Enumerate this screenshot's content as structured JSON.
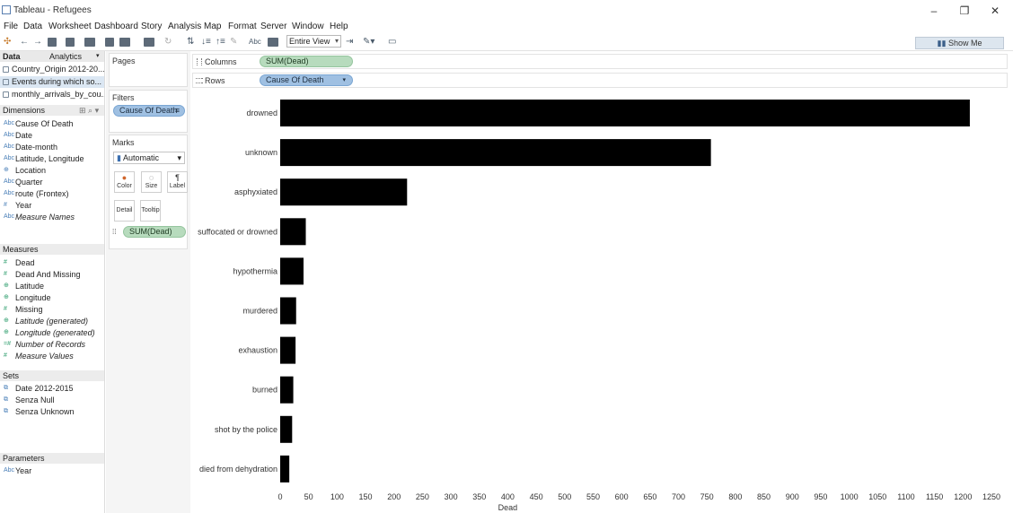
{
  "window": {
    "title": "Tableau - Refugees"
  },
  "menu": [
    "File",
    "Data",
    "Worksheet",
    "Dashboard",
    "Story",
    "Analysis",
    "Map",
    "Format",
    "Server",
    "Window",
    "Help"
  ],
  "toolbar": {
    "fit": "Entire View",
    "abc": "Abc",
    "show_me": "Show Me"
  },
  "data_pane": {
    "tabs": [
      "Data",
      "Analytics"
    ],
    "sources": [
      "Country_Origin 2012-20...",
      "Events during which so...",
      "monthly_arrivals_by_cou..."
    ],
    "dimensions_header": "Dimensions",
    "dimensions": [
      {
        "label": "Cause Of Death",
        "icon": "Abc",
        "italic": false
      },
      {
        "label": "Date",
        "icon": "Abc",
        "italic": false
      },
      {
        "label": "Date-month",
        "icon": "Abc",
        "italic": false
      },
      {
        "label": "Latitude, Longitude",
        "icon": "Abc",
        "italic": false
      },
      {
        "label": "Location",
        "icon": "⊕",
        "italic": false
      },
      {
        "label": "Quarter",
        "icon": "Abc",
        "italic": false
      },
      {
        "label": "route (Frontex)",
        "icon": "Abc",
        "italic": false
      },
      {
        "label": "Year",
        "icon": "#",
        "italic": false
      },
      {
        "label": "Measure Names",
        "icon": "Abc",
        "italic": true
      }
    ],
    "measures_header": "Measures",
    "measures": [
      {
        "label": "Dead",
        "icon": "#",
        "italic": false
      },
      {
        "label": "Dead And Missing",
        "icon": "#",
        "italic": false
      },
      {
        "label": "Latitude",
        "icon": "⊕",
        "italic": false
      },
      {
        "label": "Longitude",
        "icon": "⊕",
        "italic": false
      },
      {
        "label": "Missing",
        "icon": "#",
        "italic": false
      },
      {
        "label": "Latitude (generated)",
        "icon": "⊕",
        "italic": true
      },
      {
        "label": "Longitude (generated)",
        "icon": "⊕",
        "italic": true
      },
      {
        "label": "Number of Records",
        "icon": "=#",
        "italic": true
      },
      {
        "label": "Measure Values",
        "icon": "#",
        "italic": true
      }
    ],
    "sets_header": "Sets",
    "sets": [
      "Date 2012-2015",
      "Senza Null",
      "Senza Unknown"
    ],
    "parameters_header": "Parameters",
    "parameters": [
      {
        "label": "Year",
        "icon": "Abc"
      }
    ]
  },
  "pages": {
    "title": "Pages"
  },
  "filters": {
    "title": "Filters",
    "pill": "Cause Of Death"
  },
  "marks": {
    "title": "Marks",
    "type": "Automatic",
    "buttons": [
      "Color",
      "Size",
      "Label",
      "Detail",
      "Tooltip"
    ],
    "pill": "SUM(Dead)"
  },
  "shelves": {
    "columns_label": "Columns",
    "columns_pill": "SUM(Dead)",
    "rows_label": "Rows",
    "rows_pill": "Cause Of Death"
  },
  "chart_data": {
    "type": "bar",
    "orientation": "horizontal",
    "categories": [
      "drowned",
      "unknown",
      "asphyxiated",
      "suffocated or drowned",
      "hypothermia",
      "murdered",
      "exhaustion",
      "burned",
      "shot by the police",
      "died from dehydration"
    ],
    "values": [
      1212,
      757,
      223,
      45,
      41,
      28,
      27,
      23,
      21,
      16
    ],
    "xlabel": "Dead",
    "xticks": [
      0,
      50,
      100,
      150,
      200,
      250,
      300,
      350,
      400,
      450,
      500,
      550,
      600,
      650,
      700,
      750,
      800,
      850,
      900,
      950,
      1000,
      1050,
      1100,
      1150,
      1200,
      1250
    ],
    "xlim": [
      0,
      1250
    ],
    "bar_color": "#000000",
    "grid": false
  }
}
